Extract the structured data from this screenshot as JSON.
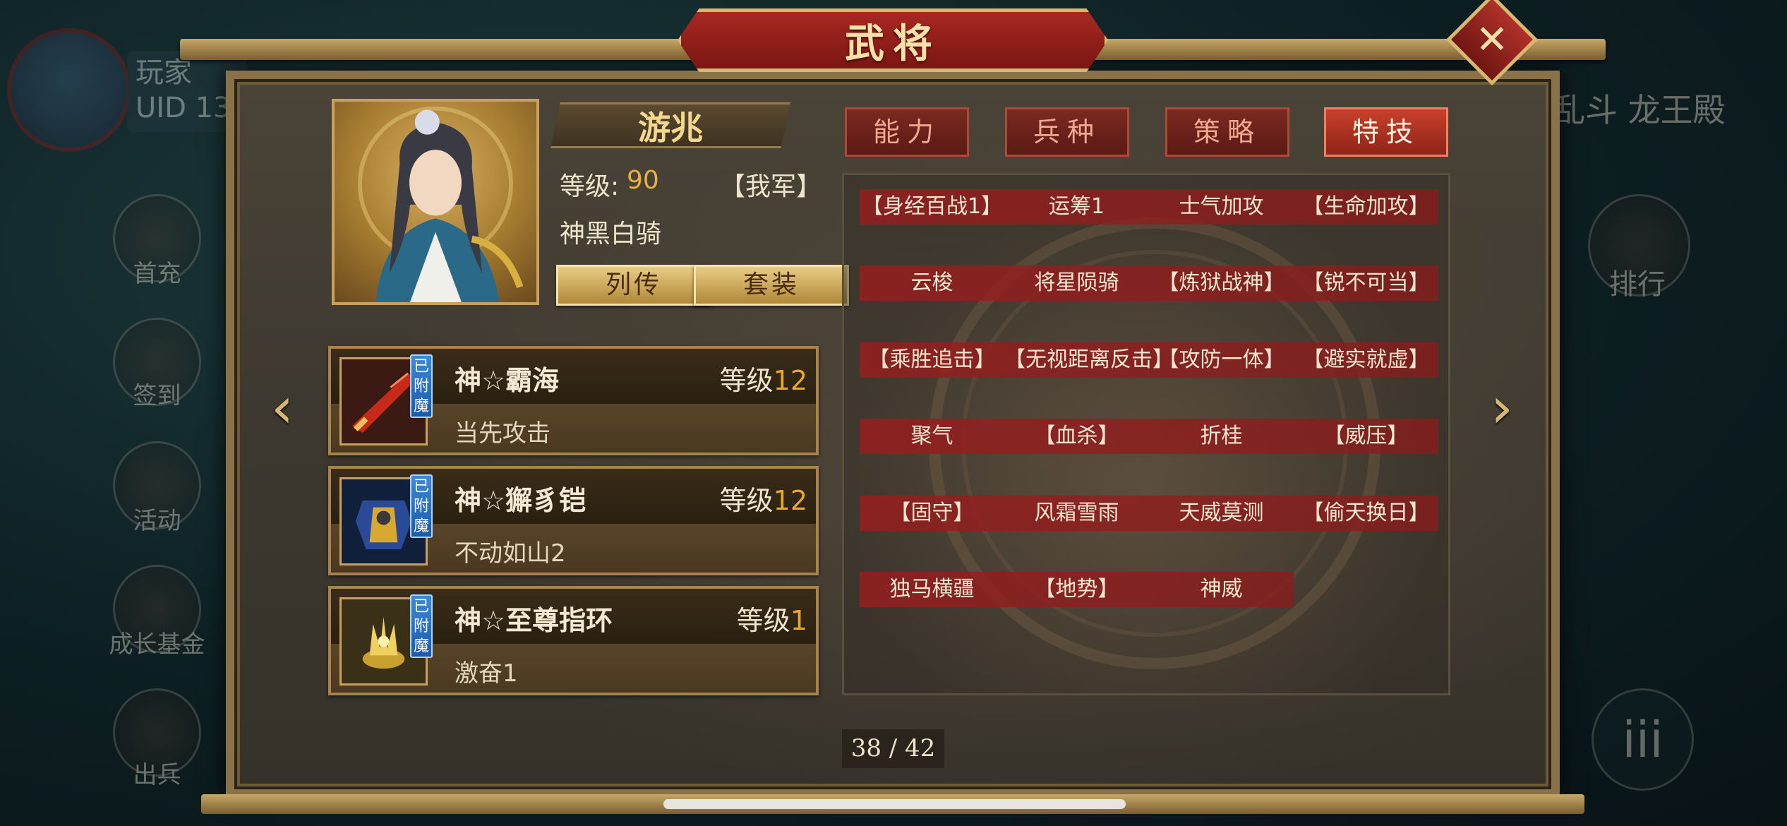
{
  "background": {
    "player_label": "玩家",
    "uid_label": "UID 13",
    "side_menu": [
      "首充",
      "签到",
      "活动",
      "成长基金",
      "出兵"
    ],
    "right_title": "乱斗 龙王殿",
    "rank_label": "排行",
    "menu_glyph": "iii"
  },
  "window": {
    "title": "武将",
    "close_glyph": "✕"
  },
  "hero": {
    "name": "游兆",
    "level_label": "等级:",
    "level": "90",
    "faction": "【我军】",
    "troop": "神黑白骑",
    "biography_button": "列传",
    "set_button": "套装"
  },
  "equipment": [
    {
      "name": "神☆霸海",
      "level_label": "等级",
      "level": "12",
      "effect": "当先攻击",
      "tag": "已附魔",
      "icon": "blade-icon"
    },
    {
      "name": "神☆獬豸铠",
      "level_label": "等级",
      "level": "12",
      "effect": "不动如山2",
      "tag": "已附魔",
      "icon": "armor-icon"
    },
    {
      "name": "神☆至尊指环",
      "level_label": "等级",
      "level": "1",
      "effect": "激奋1",
      "tag": "已附魔",
      "icon": "ring-icon"
    }
  ],
  "tabs": [
    {
      "label": "能力",
      "active": false
    },
    {
      "label": "兵种",
      "active": false
    },
    {
      "label": "策略",
      "active": false
    },
    {
      "label": "特技",
      "active": true
    }
  ],
  "skills": [
    [
      "【身经百战1】",
      "运筹1",
      "士气加攻",
      "【生命加攻】"
    ],
    [
      "云梭",
      "将星陨骑",
      "【炼狱战神】",
      "【锐不可当】"
    ],
    [
      "【乘胜追击】",
      "【无视距离反击】",
      "【攻防一体】",
      "【避实就虚】"
    ],
    [
      "聚气",
      "【血杀】",
      "折桂",
      "【威压】"
    ],
    [
      "【固守】",
      "风霜雪雨",
      "天威莫测",
      "【偷天换日】"
    ],
    [
      "独马横疆",
      "【地势】",
      "神威"
    ]
  ],
  "pagination": {
    "text": "38 / 42"
  },
  "nav": {
    "prev_glyph": "‹",
    "next_glyph": "›"
  },
  "colors": {
    "accent_red": "#a82822",
    "gold": "#d8b870",
    "level_orange": "#e8a830"
  }
}
